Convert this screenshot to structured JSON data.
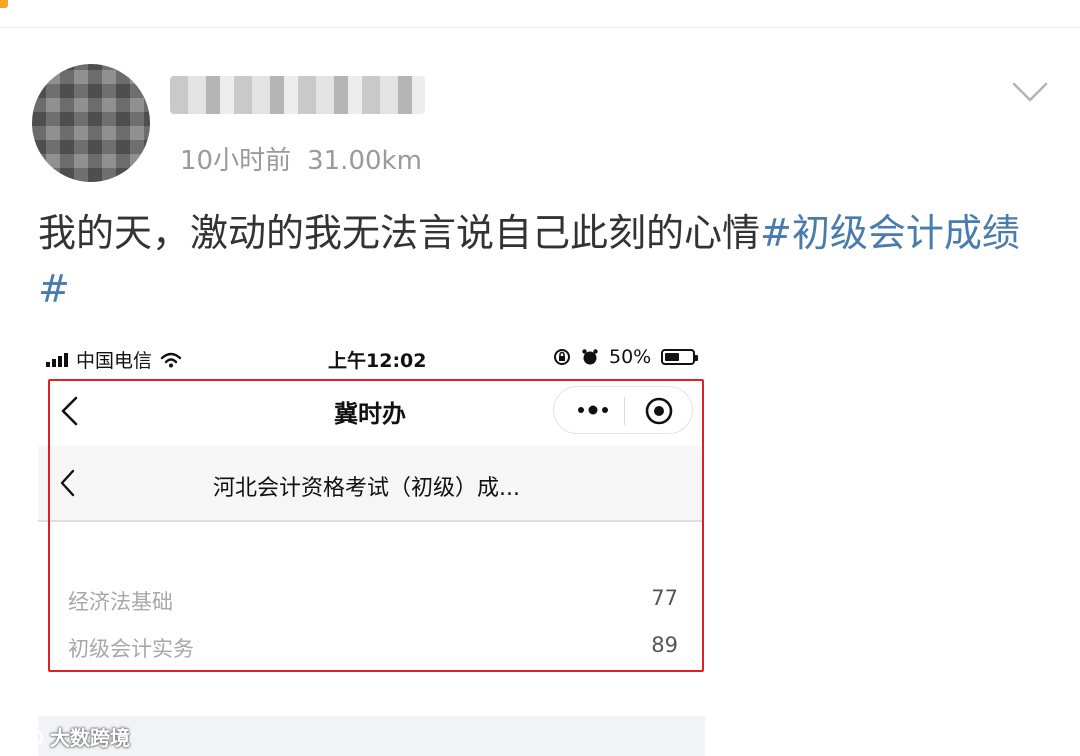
{
  "post": {
    "meta": {
      "time_ago": "10小时前",
      "distance": "31.00km"
    },
    "text": "我的天，激动的我无法言说自己此刻的心情",
    "hashtag": "#初级会计成绩#"
  },
  "screenshot": {
    "status_bar": {
      "carrier": "中国电信",
      "time": "上午12:02",
      "battery": "50%"
    },
    "nav": {
      "title": "冀时办"
    },
    "sub_header": {
      "title": "河北会计资格考试（初级）成..."
    },
    "scores": [
      {
        "subject": "经济法基础",
        "score": "77"
      },
      {
        "subject": "初级会计实务",
        "score": "89"
      }
    ]
  },
  "watermark": {
    "text": "大数跨境"
  },
  "colors": {
    "hashtag": "#4a7bad",
    "highlight": "#e02020",
    "meta": "#9a9a9a"
  }
}
